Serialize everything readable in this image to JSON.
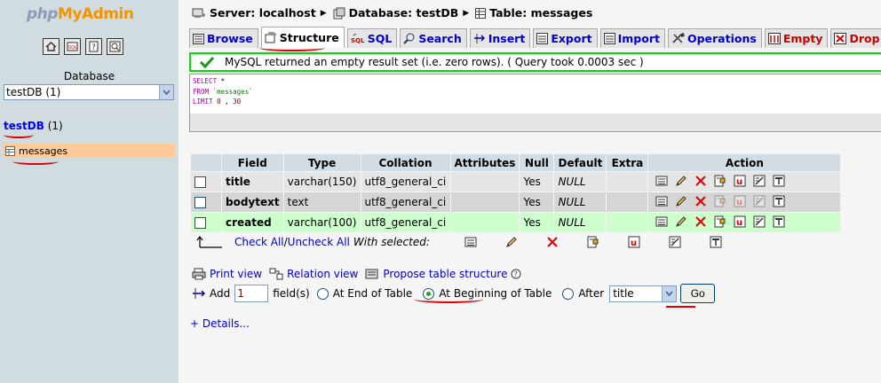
{
  "left": {
    "logo": {
      "php": "php",
      "my": "My",
      "admin": "Admin"
    },
    "icons": [
      "home-icon",
      "sql-query-icon",
      "documentation-icon",
      "query-window-icon"
    ],
    "database_label": "Database",
    "database_selected": "testDB (1)",
    "db_name": "testDB",
    "db_count": "(1)",
    "tables": [
      {
        "name": "messages"
      }
    ]
  },
  "breadcrumb": {
    "server": "Server: localhost",
    "database": "Database: testDB",
    "table": "Table: messages"
  },
  "tabs": [
    {
      "label": "Browse",
      "icon": "browse-icon"
    },
    {
      "label": "Structure",
      "icon": "structure-icon",
      "active": true
    },
    {
      "label": "SQL",
      "icon": "sql-icon"
    },
    {
      "label": "Search",
      "icon": "search-icon"
    },
    {
      "label": "Insert",
      "icon": "insert-icon"
    },
    {
      "label": "Export",
      "icon": "export-icon"
    },
    {
      "label": "Import",
      "icon": "import-icon"
    },
    {
      "label": "Operations",
      "icon": "operations-icon"
    },
    {
      "label": "Empty",
      "icon": "empty-icon",
      "danger": true
    },
    {
      "label": "Drop",
      "icon": "drop-icon",
      "danger": true
    }
  ],
  "message": "MySQL returned an empty result set (i.e. zero rows). ( Query took 0.0003 sec )",
  "sql": {
    "line1_kw": "SELECT",
    "line1_rest": " *",
    "line2_kw": "FROM",
    "line2_rest": " `messages`",
    "line3_kw": "LIMIT",
    "line3_a": "0",
    "line3_sep": " , ",
    "line3_b": "30"
  },
  "table": {
    "headers": [
      "Field",
      "Type",
      "Collation",
      "Attributes",
      "Null",
      "Default",
      "Extra",
      "Action"
    ],
    "rows": [
      {
        "field": "title",
        "type": "varchar(150)",
        "collation": "utf8_general_ci",
        "attributes": "",
        "null": "Yes",
        "default": "NULL",
        "extra": ""
      },
      {
        "field": "bodytext",
        "type": "text",
        "collation": "utf8_general_ci",
        "attributes": "",
        "null": "Yes",
        "default": "NULL",
        "extra": ""
      },
      {
        "field": "created",
        "type": "varchar(100)",
        "collation": "utf8_general_ci",
        "attributes": "",
        "null": "Yes",
        "default": "NULL",
        "extra": ""
      }
    ],
    "action_icons": [
      "browse-distinct-icon",
      "edit-icon",
      "drop-icon",
      "primary-key-icon",
      "unique-icon",
      "index-icon",
      "fulltext-icon"
    ]
  },
  "bulk": {
    "check_all": "Check All",
    "separator": " / ",
    "uncheck_all": "Uncheck All",
    "with_selected": "With selected:"
  },
  "links": {
    "print_view": "Print view",
    "relation_view": "Relation view",
    "propose": "Propose table structure"
  },
  "add": {
    "label": "Add",
    "count": "1",
    "fields": "field(s)",
    "end": "At End of Table",
    "beginning": "At Beginning of Table",
    "after": "After",
    "after_selected": "title",
    "go": "Go"
  },
  "details": "+ Details..."
}
